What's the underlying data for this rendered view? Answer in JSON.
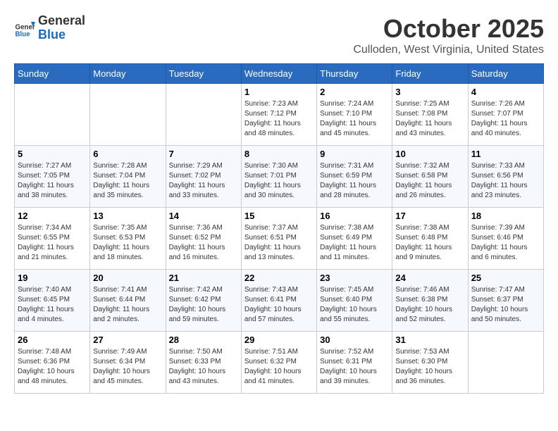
{
  "header": {
    "logo_line1": "General",
    "logo_line2": "Blue",
    "month": "October 2025",
    "location": "Culloden, West Virginia, United States"
  },
  "days_of_week": [
    "Sunday",
    "Monday",
    "Tuesday",
    "Wednesday",
    "Thursday",
    "Friday",
    "Saturday"
  ],
  "weeks": [
    [
      {
        "day": "",
        "info": ""
      },
      {
        "day": "",
        "info": ""
      },
      {
        "day": "",
        "info": ""
      },
      {
        "day": "1",
        "info": "Sunrise: 7:23 AM\nSunset: 7:12 PM\nDaylight: 11 hours and 48 minutes."
      },
      {
        "day": "2",
        "info": "Sunrise: 7:24 AM\nSunset: 7:10 PM\nDaylight: 11 hours and 45 minutes."
      },
      {
        "day": "3",
        "info": "Sunrise: 7:25 AM\nSunset: 7:08 PM\nDaylight: 11 hours and 43 minutes."
      },
      {
        "day": "4",
        "info": "Sunrise: 7:26 AM\nSunset: 7:07 PM\nDaylight: 11 hours and 40 minutes."
      }
    ],
    [
      {
        "day": "5",
        "info": "Sunrise: 7:27 AM\nSunset: 7:05 PM\nDaylight: 11 hours and 38 minutes."
      },
      {
        "day": "6",
        "info": "Sunrise: 7:28 AM\nSunset: 7:04 PM\nDaylight: 11 hours and 35 minutes."
      },
      {
        "day": "7",
        "info": "Sunrise: 7:29 AM\nSunset: 7:02 PM\nDaylight: 11 hours and 33 minutes."
      },
      {
        "day": "8",
        "info": "Sunrise: 7:30 AM\nSunset: 7:01 PM\nDaylight: 11 hours and 30 minutes."
      },
      {
        "day": "9",
        "info": "Sunrise: 7:31 AM\nSunset: 6:59 PM\nDaylight: 11 hours and 28 minutes."
      },
      {
        "day": "10",
        "info": "Sunrise: 7:32 AM\nSunset: 6:58 PM\nDaylight: 11 hours and 26 minutes."
      },
      {
        "day": "11",
        "info": "Sunrise: 7:33 AM\nSunset: 6:56 PM\nDaylight: 11 hours and 23 minutes."
      }
    ],
    [
      {
        "day": "12",
        "info": "Sunrise: 7:34 AM\nSunset: 6:55 PM\nDaylight: 11 hours and 21 minutes."
      },
      {
        "day": "13",
        "info": "Sunrise: 7:35 AM\nSunset: 6:53 PM\nDaylight: 11 hours and 18 minutes."
      },
      {
        "day": "14",
        "info": "Sunrise: 7:36 AM\nSunset: 6:52 PM\nDaylight: 11 hours and 16 minutes."
      },
      {
        "day": "15",
        "info": "Sunrise: 7:37 AM\nSunset: 6:51 PM\nDaylight: 11 hours and 13 minutes."
      },
      {
        "day": "16",
        "info": "Sunrise: 7:38 AM\nSunset: 6:49 PM\nDaylight: 11 hours and 11 minutes."
      },
      {
        "day": "17",
        "info": "Sunrise: 7:38 AM\nSunset: 6:48 PM\nDaylight: 11 hours and 9 minutes."
      },
      {
        "day": "18",
        "info": "Sunrise: 7:39 AM\nSunset: 6:46 PM\nDaylight: 11 hours and 6 minutes."
      }
    ],
    [
      {
        "day": "19",
        "info": "Sunrise: 7:40 AM\nSunset: 6:45 PM\nDaylight: 11 hours and 4 minutes."
      },
      {
        "day": "20",
        "info": "Sunrise: 7:41 AM\nSunset: 6:44 PM\nDaylight: 11 hours and 2 minutes."
      },
      {
        "day": "21",
        "info": "Sunrise: 7:42 AM\nSunset: 6:42 PM\nDaylight: 10 hours and 59 minutes."
      },
      {
        "day": "22",
        "info": "Sunrise: 7:43 AM\nSunset: 6:41 PM\nDaylight: 10 hours and 57 minutes."
      },
      {
        "day": "23",
        "info": "Sunrise: 7:45 AM\nSunset: 6:40 PM\nDaylight: 10 hours and 55 minutes."
      },
      {
        "day": "24",
        "info": "Sunrise: 7:46 AM\nSunset: 6:38 PM\nDaylight: 10 hours and 52 minutes."
      },
      {
        "day": "25",
        "info": "Sunrise: 7:47 AM\nSunset: 6:37 PM\nDaylight: 10 hours and 50 minutes."
      }
    ],
    [
      {
        "day": "26",
        "info": "Sunrise: 7:48 AM\nSunset: 6:36 PM\nDaylight: 10 hours and 48 minutes."
      },
      {
        "day": "27",
        "info": "Sunrise: 7:49 AM\nSunset: 6:34 PM\nDaylight: 10 hours and 45 minutes."
      },
      {
        "day": "28",
        "info": "Sunrise: 7:50 AM\nSunset: 6:33 PM\nDaylight: 10 hours and 43 minutes."
      },
      {
        "day": "29",
        "info": "Sunrise: 7:51 AM\nSunset: 6:32 PM\nDaylight: 10 hours and 41 minutes."
      },
      {
        "day": "30",
        "info": "Sunrise: 7:52 AM\nSunset: 6:31 PM\nDaylight: 10 hours and 39 minutes."
      },
      {
        "day": "31",
        "info": "Sunrise: 7:53 AM\nSunset: 6:30 PM\nDaylight: 10 hours and 36 minutes."
      },
      {
        "day": "",
        "info": ""
      }
    ]
  ]
}
